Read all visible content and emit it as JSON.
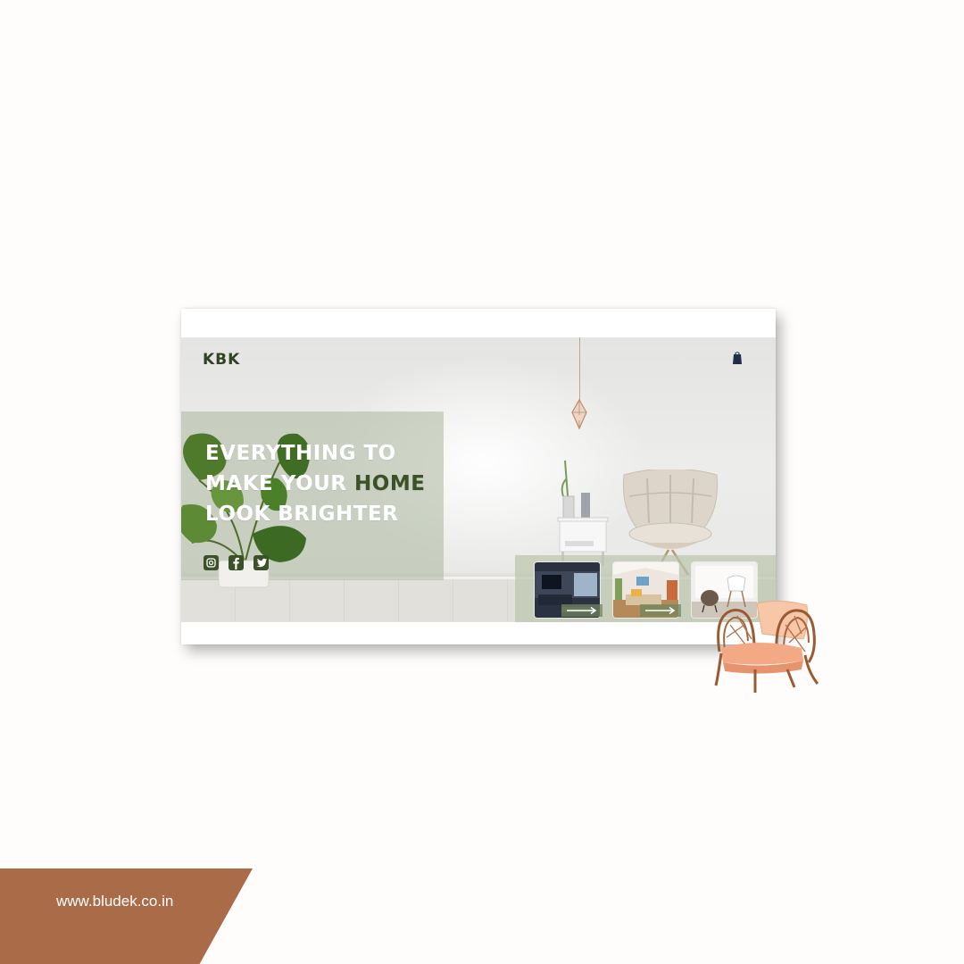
{
  "header": {
    "logo": "KBK",
    "cart_icon": "shopping-bag-icon"
  },
  "hero": {
    "headline_line1": "EVERYTHING TO",
    "headline_line2_prefix": "MAKE YOUR ",
    "headline_line2_accent": "HOME",
    "headline_line3": "LOOK BRIGHTER",
    "accent_color": "#3b5128",
    "panel_color": "#acb89e",
    "social_icons": [
      "instagram-icon",
      "facebook-icon",
      "twitter-icon"
    ]
  },
  "gallery": {
    "thumbnails": [
      "living-room-thumbnail",
      "bedroom-thumbnail",
      "chair-room-thumbnail"
    ],
    "arrow_icon": "right-arrow-icon"
  },
  "footer": {
    "website": "www.bludek.co.in",
    "banner_color": "#a96b48"
  }
}
